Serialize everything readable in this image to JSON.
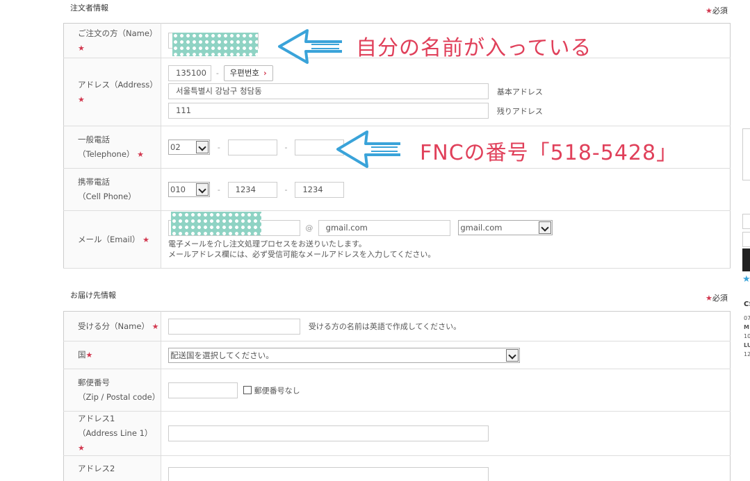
{
  "orderer": {
    "section_title": "注文者情報",
    "required_note": "必須",
    "name_label": "ご注文の方（Name）",
    "address_label": "アドレス（Address）",
    "zip_value": "135100",
    "zip_button": "우편번호",
    "address_base_value": "서울특별시 강남구 청담동",
    "address_base_hint": "基本アドレス",
    "address_rest_value": "111",
    "address_rest_hint": "残りアドレス",
    "tel_label_1": "一般電話",
    "tel_label_2": "（Telephone）",
    "tel_area": "02",
    "cell_label_1": "携帯電話",
    "cell_label_2": "（Cell Phone）",
    "cell_area": "010",
    "cell_mid": "1234",
    "cell_last": "1234",
    "email_label": "メール（Email）",
    "email_at": "@",
    "email_domain": "gmail.com",
    "email_domain_select": "gmail.com",
    "email_note_1": "電子メールを介し注文処理プロセスをお送りいたします。",
    "email_note_2": "メールアドレス欄には、必ず受信可能なメールアドレスを入力してください。",
    "dash": "-"
  },
  "annotations": {
    "name_annotation": "自分の名前が入っている",
    "tel_annotation": "FNCの番号「518-5428」"
  },
  "delivery": {
    "section_title": "お届け先情報",
    "required_note": "必須",
    "recipient_label": "受ける分（Name）",
    "recipient_hint": "受ける方の名前は英語で作成してください。",
    "country_label": "国",
    "country_select": "配送国を選択してください。",
    "zip_label_1": "郵便番号",
    "zip_label_2": "（Zip / Postal code）",
    "no_zip_label": "郵便番号なし",
    "addr1_label_1": "アドレス1",
    "addr1_label_2": "（Address Line 1）",
    "addr2_label_1": "アドレス2"
  },
  "sidebar": {
    "cs_label": "CS",
    "line1": "07",
    "line2": "M",
    "line3": "10",
    "line4": "LU",
    "line5": "12"
  },
  "colors": {
    "required_star": "#d2384f",
    "annotation": "#e0405a",
    "arrow": "#3aa3d9"
  }
}
